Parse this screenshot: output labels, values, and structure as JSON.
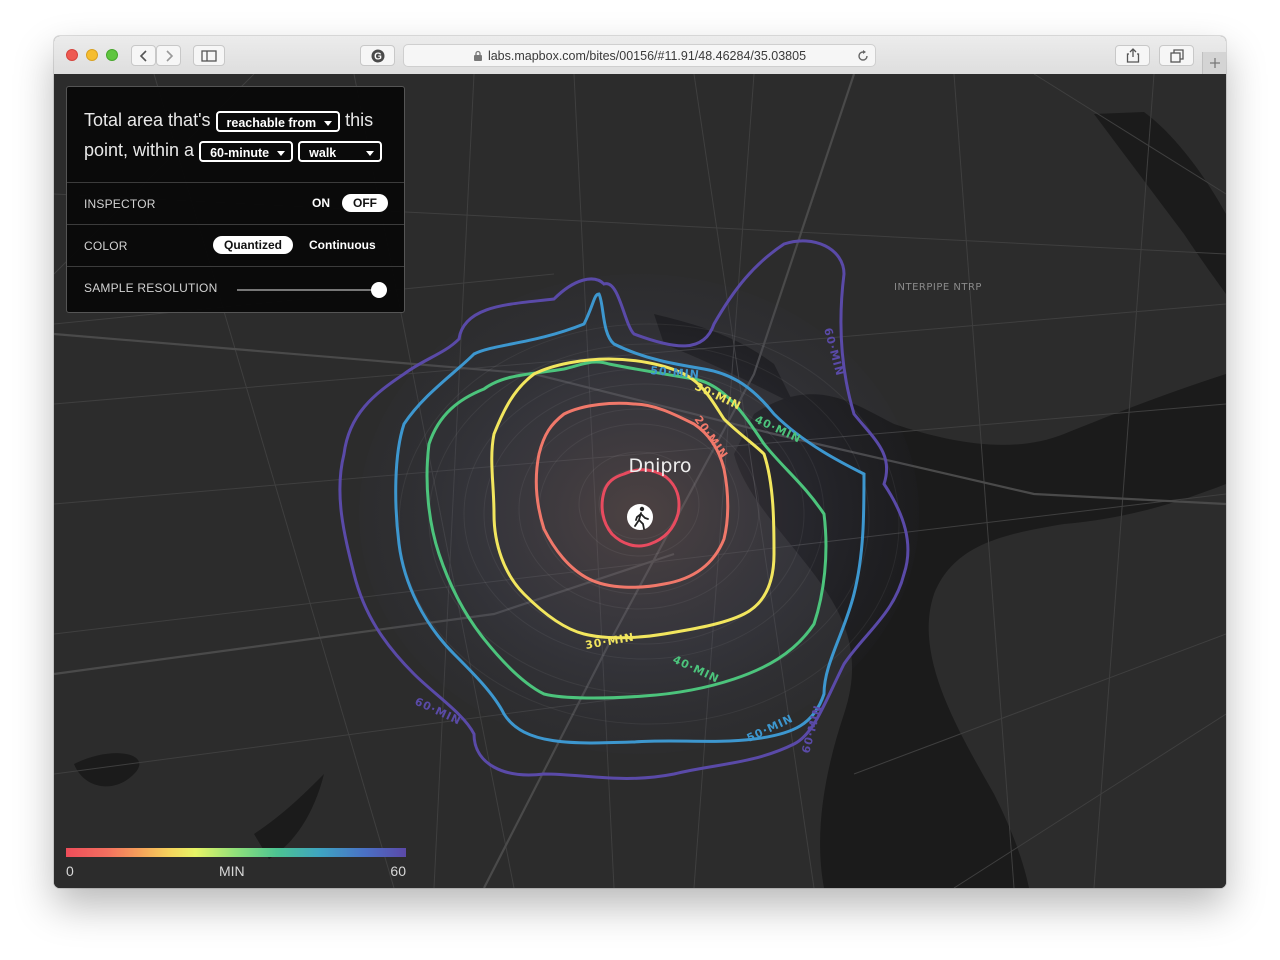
{
  "browser": {
    "url": "labs.mapbox.com/bites/00156/#11.91/48.46284/35.03805",
    "icons": [
      "back-icon",
      "forward-icon",
      "sidebar-icon",
      "grammarly-icon",
      "lock-icon",
      "reload-icon",
      "share-icon",
      "tabs-icon",
      "new-tab-icon"
    ]
  },
  "panel": {
    "question": {
      "prefix": "Total area that's",
      "direction_selected": "reachable from",
      "middle": "this point, within a",
      "time_selected": "60-minute",
      "mode_selected": "walk"
    },
    "inspector": {
      "label": "INSPECTOR",
      "on": "ON",
      "off": "OFF",
      "selected": "OFF"
    },
    "color": {
      "label": "COLOR",
      "quantized": "Quantized",
      "continuous": "Continuous",
      "selected": "Quantized"
    },
    "sample_resolution": {
      "label": "SAMPLE RESOLUTION",
      "value_fraction": 1.0
    }
  },
  "map": {
    "city": "Dnipro",
    "place_labels": [
      "INTERPIPE NTRP"
    ],
    "isochrones": [
      {
        "minutes": 10,
        "color": "#e84b5f"
      },
      {
        "minutes": 20,
        "color": "#f0786a",
        "label": "20·MIN"
      },
      {
        "minutes": 30,
        "color": "#f2e65e",
        "label": "30·MIN"
      },
      {
        "minutes": 40,
        "color": "#4cc47c",
        "label": "40·MIN"
      },
      {
        "minutes": 50,
        "color": "#3d97cf",
        "label": "50·MIN"
      },
      {
        "minutes": 60,
        "color": "#5a4aa8",
        "label": "60·MIN"
      }
    ],
    "origin_icon": "walking-person-icon"
  },
  "legend": {
    "min": "0",
    "unit": "MIN",
    "max": "60"
  }
}
